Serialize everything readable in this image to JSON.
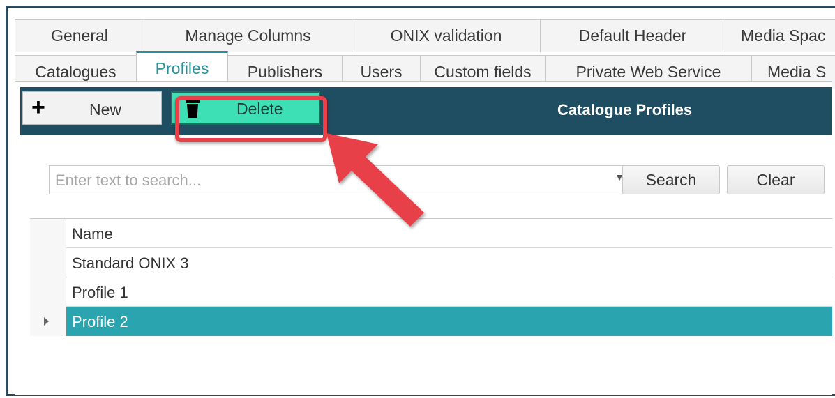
{
  "tabs_top": [
    "General",
    "Manage Columns",
    "ONIX validation",
    "Default Header",
    "Media Spac"
  ],
  "tabs_bottom": [
    "Catalogues",
    "Profiles",
    "Publishers",
    "Users",
    "Custom fields",
    "Private Web Service",
    "Media S"
  ],
  "active_tab": "Profiles",
  "toolbar": {
    "new_label": "New",
    "delete_label": "Delete",
    "title": "Catalogue Profiles"
  },
  "search": {
    "placeholder": "Enter text to search...",
    "search_label": "Search",
    "clear_label": "Clear"
  },
  "grid": {
    "header": "Name",
    "rows": [
      "Standard ONIX 3",
      "Profile 1",
      "Profile 2"
    ],
    "selected_row": 2
  },
  "colors": {
    "toolbar_bg": "#1f4e62",
    "delete_bg": "#3de0b4",
    "highlight": "#e8414a",
    "selected_row": "#2aa5b0",
    "active_tab": "#2c8f9c"
  },
  "icons": {
    "new": "plus-icon",
    "delete": "trash-icon",
    "dropdown": "chevron-down-icon",
    "row_pointer": "row-pointer-icon"
  }
}
